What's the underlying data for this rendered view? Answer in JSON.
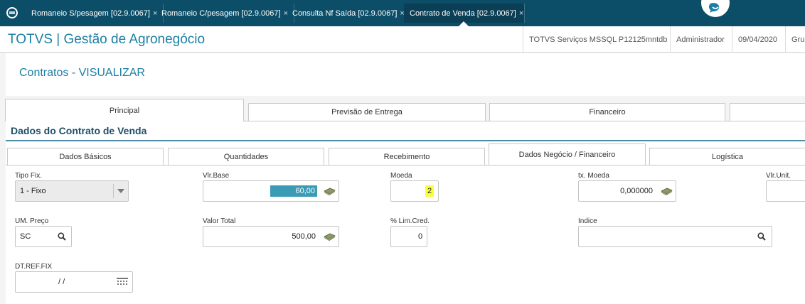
{
  "window": {
    "tabs": [
      {
        "label": "Romaneio S/pesagem [02.9.0067]"
      },
      {
        "label": "Romaneio C/pesagem [02.9.0067]"
      },
      {
        "label": "Consulta Nf Saída [02.9.0067]"
      },
      {
        "label": "Contrato de Venda [02.9.0067]"
      }
    ],
    "active_tab": 3,
    "close_glyph": "×"
  },
  "header": {
    "app_title": "TOTVS | Gestão de Agronegócio",
    "server": "TOTVS Serviços MSSQL P12125mntdb",
    "user": "Administrador",
    "date": "09/04/2020",
    "group": "Gru"
  },
  "page": {
    "title": "Contratos - VISUALIZAR"
  },
  "main_tabs": [
    {
      "label": "Principal"
    },
    {
      "label": "Previsão de Entrega"
    },
    {
      "label": "Financeiro"
    },
    {
      "label": ""
    }
  ],
  "section": {
    "title": "Dados do Contrato de Venda"
  },
  "sub_tabs": [
    {
      "label": "Dados Básicos"
    },
    {
      "label": "Quantidades"
    },
    {
      "label": "Recebimento"
    },
    {
      "label": "Dados Negócio / Financeiro"
    },
    {
      "label": "Logística"
    }
  ],
  "fields": {
    "tipo_fix": {
      "label": "Tipo Fix.",
      "value": "1 - Fixo"
    },
    "vlr_base": {
      "label": "Vlr.Base",
      "value": "60,00"
    },
    "moeda": {
      "label": "Moeda",
      "value": "2"
    },
    "tx_moeda": {
      "label": "tx. Moeda",
      "value": "0,000000"
    },
    "vlr_unit": {
      "label": "Vlr.Unit.",
      "value": ""
    },
    "um_preco": {
      "label": "UM. Preço",
      "value": "SC"
    },
    "valor_total": {
      "label": "Valor Total",
      "value": "500,00"
    },
    "lim_cred": {
      "label": "% Lim.Cred.",
      "value": "0"
    },
    "indice": {
      "label": "Indice",
      "value": ""
    },
    "dt_ref_fix": {
      "label": "DT.REF.FIX",
      "value": "/ /"
    }
  },
  "icons": {
    "money": "money-icon",
    "search": "search-icon",
    "calendar": "calendar-icon",
    "dropdown": "chevron-down-icon"
  },
  "colors": {
    "topbar": "#0c4e67",
    "brand": "#1b7fa3",
    "section_title": "#1e4f66",
    "selection": "#3a9bb5",
    "highlight": "#f8ff3c"
  }
}
